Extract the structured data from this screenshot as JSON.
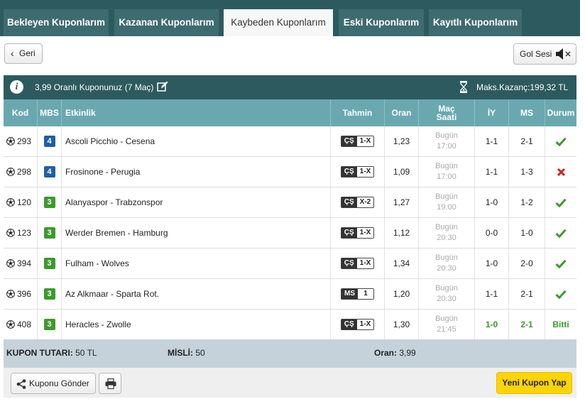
{
  "tabs": [
    {
      "label": "Bekleyen Kuponlarım"
    },
    {
      "label": "Kazanan Kuponlarım"
    },
    {
      "label": "Kaybeden Kuponlarım"
    },
    {
      "label": "Eski Kuponlarım"
    },
    {
      "label": "Kayıtlı Kuponlarım"
    }
  ],
  "active_tab": "Kaybeden Kuponlarım",
  "back_label": "Geri",
  "sound_label": "Gol Sesi",
  "coupon": {
    "title": "3,99 Oranlı Kuponunuz (7 Maç)",
    "max_win": "Maks.Kazanç:199,32 TL"
  },
  "columns": {
    "code": "Kod",
    "mbs": "MBS",
    "event": "Etkinlik",
    "pick": "Tahmin",
    "odds": "Oran",
    "time_1": "Maç",
    "time_2": "Saati",
    "ht": "İY",
    "ft": "MS",
    "status": "Durum"
  },
  "rows": [
    {
      "code": "293",
      "mbs": "4",
      "event": "Ascoli Picchio - Cesena",
      "bet_type": "ÇŞ",
      "pick": "1-X",
      "odds": "1,23",
      "day": "Bugün",
      "time": "17:00",
      "ht": "1-1",
      "ft": "2-1",
      "status": "won"
    },
    {
      "code": "298",
      "mbs": "4",
      "event": "Frosinone - Perugia",
      "bet_type": "ÇŞ",
      "pick": "1-X",
      "odds": "1,09",
      "day": "Bugün",
      "time": "17:00",
      "ht": "1-1",
      "ft": "1-3",
      "status": "lost"
    },
    {
      "code": "120",
      "mbs": "3",
      "event": "Alanyaspor - Trabzonspor",
      "bet_type": "ÇŞ",
      "pick": "X-2",
      "odds": "1,27",
      "day": "Bugün",
      "time": "19:00",
      "ht": "1-0",
      "ft": "1-2",
      "status": "won"
    },
    {
      "code": "123",
      "mbs": "3",
      "event": "Werder Bremen - Hamburg",
      "bet_type": "ÇŞ",
      "pick": "1-X",
      "odds": "1,12",
      "day": "Bugün",
      "time": "20:30",
      "ht": "0-0",
      "ft": "1-0",
      "status": "won"
    },
    {
      "code": "394",
      "mbs": "3",
      "event": "Fulham - Wolves",
      "bet_type": "ÇŞ",
      "pick": "1-X",
      "odds": "1,34",
      "day": "Bugün",
      "time": "20:30",
      "ht": "1-0",
      "ft": "2-0",
      "status": "won"
    },
    {
      "code": "396",
      "mbs": "3",
      "event": "Az Alkmaar - Sparta Rot.",
      "bet_type": "MS",
      "pick": "1",
      "odds": "1,20",
      "day": "Bugün",
      "time": "20:30",
      "ht": "1-1",
      "ft": "2-1",
      "status": "won"
    },
    {
      "code": "408",
      "mbs": "3",
      "event": "Heracles - Zwolle",
      "bet_type": "ÇŞ",
      "pick": "1-X",
      "odds": "1,30",
      "day": "Bugün",
      "time": "21:45",
      "ht": "1-0",
      "ft": "2-1",
      "status": "Bitti"
    }
  ],
  "summary": {
    "amount_label": "KUPON TUTARI:",
    "amount_value": "50 TL",
    "multiplier_label": "MİSLİ:",
    "multiplier_value": "50",
    "odds_label": "Oran:",
    "odds_value": "3,99"
  },
  "send_label": "Kuponu Gönder",
  "new_coupon_label": "Yeni Kupon Yap",
  "colors": {
    "header_dark": "#2c5a5f",
    "table_header": "#6aa8b0",
    "win_green": "#3c9a2c",
    "loss_red": "#d0241b",
    "mbs_blue": "#1e5fa8",
    "accent_yellow": "#ffd400"
  }
}
